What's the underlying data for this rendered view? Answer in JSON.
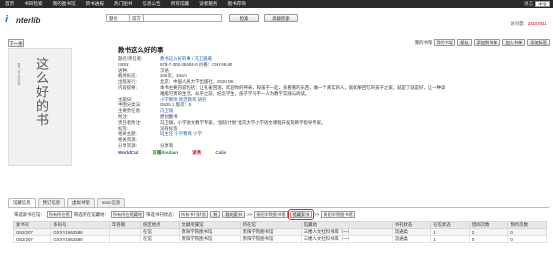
{
  "topnav": {
    "items": [
      "首页",
      "书目检索",
      "我的图书馆",
      "新书通报",
      "热门图书",
      "信息公告",
      "所有馆藏",
      "读者服务",
      "图书荐购"
    ],
    "lang_label": "语言",
    "lang_value": "中文"
  },
  "header": {
    "logo_letter": "i",
    "logo_text": "nterlib",
    "search_field": "题名",
    "search_type": "前方",
    "search_btn": "检索",
    "adv_btn": "高级检索",
    "visit_label": "访问量：",
    "visit_count": "23157811"
  },
  "next_btn": "下一条",
  "actions": {
    "folder_label": "我的书架",
    "folder_value": "我的书架",
    "save_btn": "保存",
    "add_cart_btn": "添加到书车",
    "add_list_btn": "加入书单",
    "add_tag_btn": "添加标签"
  },
  "cover": {
    "big_text": "这么好的书",
    "small_text": "教书 这么好的事"
  },
  "book": {
    "title": "教书这么好的事",
    "fields": [
      {
        "k": "题名/责任者:",
        "v": "教书这么好的事 / 冯卫雄著",
        "link": true
      },
      {
        "k": "ISBN:",
        "v": "978-7-300-28404-0 价格：CNY49.80",
        "link": false
      },
      {
        "k": "语种:",
        "v": "汉语",
        "link": false
      },
      {
        "k": "载体形态:",
        "v": "206页；24cm",
        "link": false
      },
      {
        "k": "出版发行:",
        "v": "北京：中国人民大学出版社，2020.08",
        "link": false
      },
      {
        "k": "内容提要:",
        "v": "本书主要内容包括：让孔雀回荡，欢迎你的神采，和孩子一起，多看看的东西，做一个真实的人，就如果回忆的孩子之家，就是了就是好，让一种读",
        "link": false
      },
      {
        "k": "",
        "v": "难能可贵的生活，似乎之前，纪念学生，孩子学习不一人为教学实践与阅读。",
        "link": false
      },
      {
        "k": "主题词:",
        "v": "小学教师 师范教育 研究",
        "link": true
      },
      {
        "k": "中图分类法:",
        "v": "G625.1 版次：5",
        "link": false
      },
      {
        "k": "主要责任者:",
        "v": "冯卫雄",
        "link": true
      },
      {
        "k": "附注:",
        "v": "原创图书",
        "link": false
      },
      {
        "k": "责任者附注:",
        "v": "冯卫雄，小学语文教学专家，“国培计划”北京大学小学语文课程开发及教学指导专家。",
        "link": false
      },
      {
        "k": "标签:",
        "v": "没有标签",
        "link": false
      },
      {
        "k": "相关主题:",
        "v": "班主任   小学教育   小学",
        "link": true
      },
      {
        "k": "相关资源:",
        "v": "",
        "link": false
      },
      {
        "k": "分享资源:",
        "v": "分享到",
        "link": false
      }
    ],
    "share_logos": [
      "WorldCat",
      "豆瓣douban",
      "读秀",
      "Calis"
    ]
  },
  "tabs": [
    "馆藏信息",
    "预订信息",
    "虚拟书架",
    "marc信息"
  ],
  "filter": {
    "loc_label": "筛选索书在馆：",
    "loc_value": "所有所在馆",
    "campus_label": "筛选所在馆藏地：",
    "campus_value": "所有所在馆藏地",
    "status_label": "筛选书刊状态：",
    "status_value": "所有书刊状态",
    "go_btn": "到",
    "borrow_btn": "我的索书",
    "arrow1": ">>",
    "target1": "贵阳学院图书馆",
    "hl_btn": "馆藏索书",
    "arrow2": ">>",
    "target2": "贵阳学院图书馆"
  },
  "table": {
    "headers": [
      "索书号",
      "条码号",
      "年卷期",
      "校区地点",
      "文献所属馆",
      "所在馆",
      "馆藏地",
      "书刊状态",
      "在馆状态",
      "借阅次数",
      "预约次数"
    ],
    "rows": [
      [
        "G62/207",
        "GXXY1662586",
        "",
        "在馆",
        "贵阳学院图书馆",
        "贵阳学院图书馆",
        "三楼人文社科书库（一）",
        "流通类",
        "1",
        "2",
        "0"
      ],
      [
        "G62/207",
        "GXXY1662588",
        "",
        "在馆",
        "贵阳学院图书馆",
        "贵阳学院图书馆",
        "三楼人文社科书库（一）",
        "流通类",
        "1",
        "0",
        "0"
      ]
    ]
  }
}
